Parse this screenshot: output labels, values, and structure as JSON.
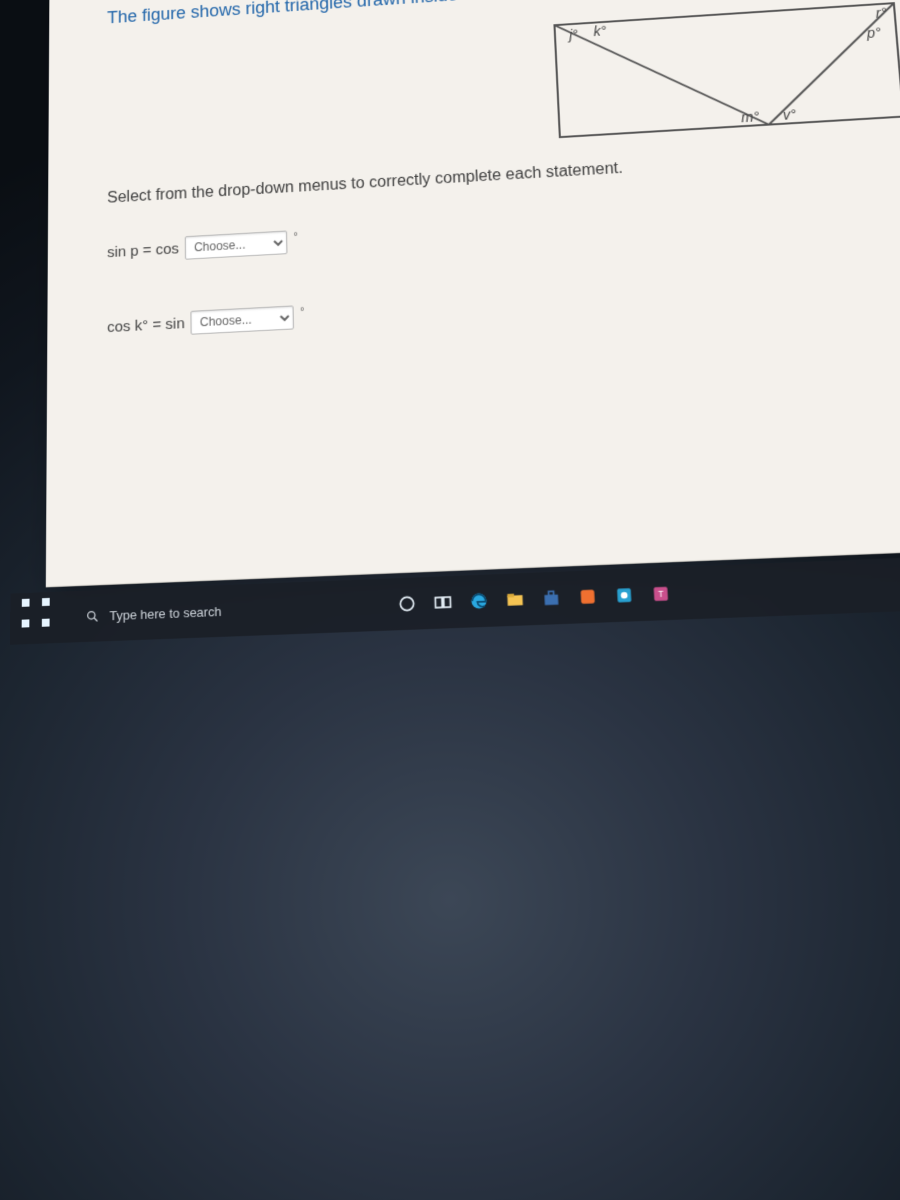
{
  "question": {
    "prompt": "The figure shows right triangles drawn inside of a rectangle.",
    "instruction": "Select from the drop-down menus to correctly complete each statement.",
    "diagram_labels": {
      "j": "j°",
      "k": "k°",
      "m": "m°",
      "v": "v°",
      "r": "r°",
      "p": "p°"
    },
    "statements": [
      {
        "prefix": "sin p = cos",
        "dropdown_placeholder": "Choose...",
        "suffix": "°"
      },
      {
        "prefix": "cos k° = sin",
        "dropdown_placeholder": "Choose...",
        "suffix": "°"
      }
    ]
  },
  "taskbar": {
    "search_placeholder": "Type here to search"
  }
}
